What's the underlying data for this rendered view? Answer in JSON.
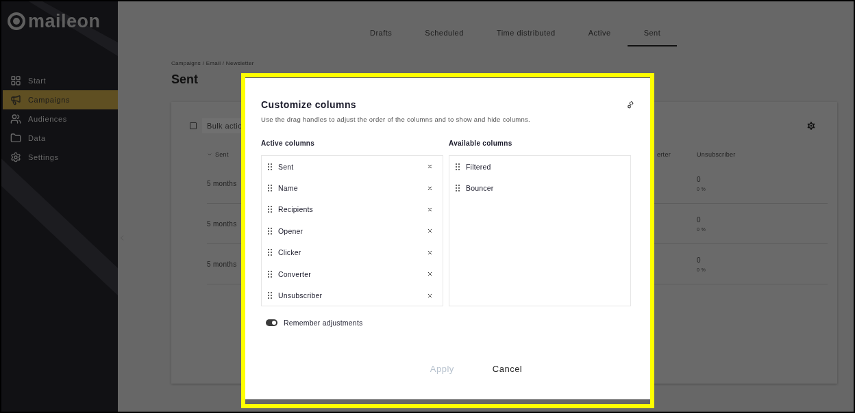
{
  "sidebar": {
    "logo": "maileon",
    "items": [
      {
        "label": "Start",
        "selected": false
      },
      {
        "label": "Campaigns",
        "selected": true
      },
      {
        "label": "Audiences",
        "selected": false
      },
      {
        "label": "Data",
        "selected": false
      },
      {
        "label": "Settings",
        "selected": false
      }
    ]
  },
  "tabs": [
    {
      "label": "Drafts",
      "selected": false
    },
    {
      "label": "Scheduled",
      "selected": false
    },
    {
      "label": "Time distributed",
      "selected": false
    },
    {
      "label": "Active",
      "selected": false
    },
    {
      "label": "Sent",
      "selected": true
    }
  ],
  "breadcrumb": "Campaigns / Email / Newsletter",
  "page_title": "Sent",
  "table": {
    "select_all": {
      "checked": false
    },
    "bulk_actions": "Bulk actio",
    "columns": [
      {
        "label": "Sent",
        "sorted": true
      },
      {
        "label": "erter",
        "sorted": false
      },
      {
        "label": "Unsubscriber",
        "sorted": false
      }
    ],
    "rows": [
      {
        "sent": "5 months",
        "unsubscriber": "0",
        "unsubscriber_share": "0 %"
      },
      {
        "sent": "5 months",
        "unsubscriber": "0",
        "unsubscriber_share": "0 %"
      },
      {
        "sent": "5 months",
        "unsubscriber": "0",
        "unsubscriber_share": "0 %"
      }
    ]
  },
  "dialog": {
    "title": "Customize columns",
    "description": "Use the drag handles to adjust the order of the columns and to show and hide columns.",
    "active_heading": "Active columns",
    "available_heading": "Available columns",
    "active_columns": [
      "Sent",
      "Name",
      "Recipients",
      "Opener",
      "Clicker",
      "Converter",
      "Unsubscriber"
    ],
    "available_columns": [
      "Filtered",
      "Bouncer"
    ],
    "remember": {
      "label": "Remember adjustments",
      "on": true
    },
    "buttons": [
      {
        "label": "Apply",
        "disabled": true
      },
      {
        "label": "Cancel",
        "disabled": false
      }
    ]
  }
}
